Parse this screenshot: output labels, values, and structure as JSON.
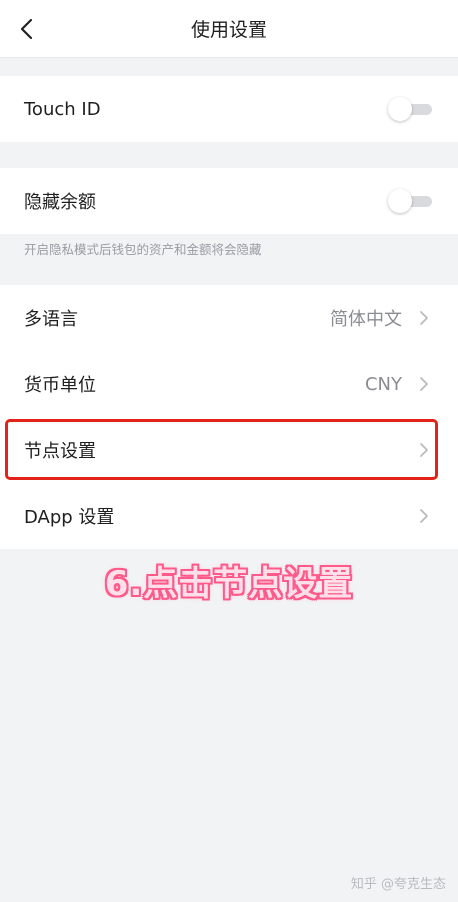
{
  "header": {
    "title": "使用设置"
  },
  "touch_id": {
    "label": "Touch ID",
    "enabled": false
  },
  "hide_balance": {
    "label": "隐藏余额",
    "enabled": false,
    "hint": "开启隐私模式后钱包的资产和金额将会隐藏"
  },
  "settings": [
    {
      "label": "多语言",
      "value": "简体中文"
    },
    {
      "label": "货币单位",
      "value": "CNY"
    },
    {
      "label": "节点设置",
      "value": ""
    },
    {
      "label": "DApp 设置",
      "value": ""
    }
  ],
  "overlay": {
    "caption": "6.点击节点设置"
  },
  "watermark": {
    "text": "知乎 @夸克生态"
  },
  "colors": {
    "background": "#f2f3f5",
    "card": "#ffffff",
    "highlight_border": "#e2231a",
    "caption_stroke": "#ff5a8a"
  }
}
